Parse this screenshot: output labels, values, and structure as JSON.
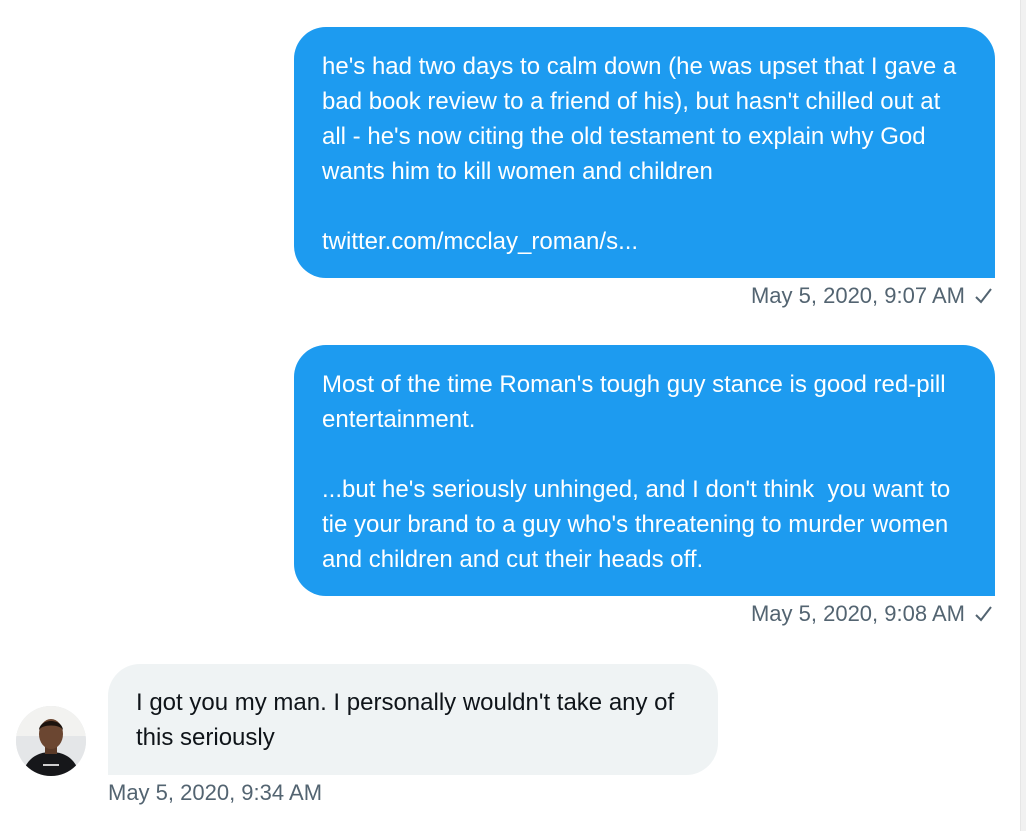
{
  "messages": [
    {
      "direction": "sent",
      "text": "he's had two days to calm down (he was upset that I gave a bad book review to a friend of his), but hasn't chilled out at all - he's now citing the old testament to explain why God wants him to kill women and children\n\ntwitter.com/mcclay_roman/s...",
      "timestamp": "May 5, 2020, 9:07 AM",
      "status_icon": "checkmark-icon"
    },
    {
      "direction": "sent",
      "text": "Most of the time Roman's tough guy stance is good red-pill entertainment.\n\n...but he's seriously unhinged, and I don't think  you want to tie your brand to a guy who's threatening to murder women and children and cut their heads off.",
      "timestamp": "May 5, 2020, 9:08 AM",
      "status_icon": "checkmark-icon"
    },
    {
      "direction": "received",
      "text": "I got you my man. I personally wouldn't take any of this seriously",
      "timestamp": "May 5, 2020, 9:34 AM",
      "avatar": "user-avatar"
    }
  ],
  "colors": {
    "sent_bubble": "#1d9bf0",
    "sent_text": "#ffffff",
    "received_bubble": "#eff3f4",
    "received_text": "#0f1419",
    "timestamp": "#536471"
  }
}
